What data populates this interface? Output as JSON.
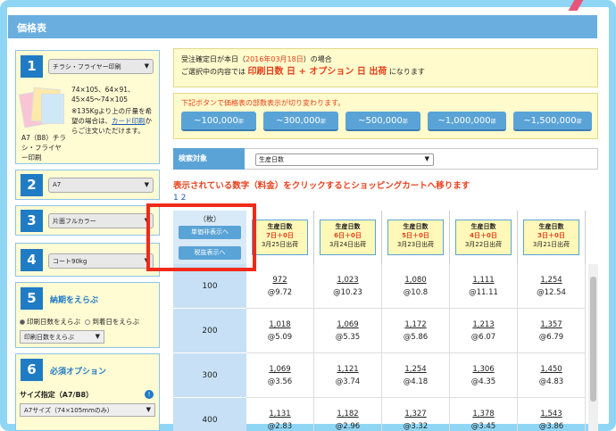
{
  "header": {
    "title": "価格表"
  },
  "sidebar": {
    "s1": {
      "num": "1",
      "select": "チラシ・フライヤー印刷",
      "sizes": "74×105、64×91、45×45〜74×105",
      "note1": "※135Kgより上の斤量を希望の場合は、",
      "note_link": "カード印刷",
      "note2": "からご注文いただけます。",
      "caption": "A7（B8）チラシ・フライヤー印刷"
    },
    "s2": {
      "num": "2",
      "select": "A7"
    },
    "s3": {
      "num": "3",
      "select": "片面フルカラー"
    },
    "s4": {
      "num": "4",
      "select": "コート90kg"
    },
    "s5": {
      "num": "5",
      "title": "納期をえらぶ",
      "radio1": "印刷日数をえらぶ",
      "radio2": "到着日をえらぶ",
      "select": "印刷日数をえらぶ"
    },
    "s6": {
      "num": "6",
      "title": "必須オプション",
      "sub": "サイズ指定（A7/B8）",
      "select": "A7サイズ（74×105mmのみ）"
    }
  },
  "notice": {
    "line1a": "受注確定日が本日（",
    "date": "2016年03月18日",
    "line1b": "）の場合",
    "line2a": "ご選択中の内容では ",
    "days": "印刷日数 日",
    "plus": " + ",
    "opt": "オプション 日 出荷",
    "line2b": " になります"
  },
  "qty": {
    "note": "下記ボタンで価格表の部数表示が切り変わります。",
    "buttons": [
      {
        "label": "~100,000",
        "unit": "部"
      },
      {
        "label": "~300,000",
        "unit": "部"
      },
      {
        "label": "~500,000",
        "unit": "部"
      },
      {
        "label": "~1,000,000",
        "unit": "部"
      },
      {
        "label": "~1,500,000",
        "unit": "部"
      }
    ]
  },
  "filter": {
    "label": "検索対象",
    "select": "生産日数"
  },
  "info": "表示されている数字（料金）をクリックするとショッピングカートへ移ります",
  "pages": "1 2",
  "table": {
    "corner": "（枚）",
    "btn_unit": "単価非表示へ",
    "btn_tax": "税抜表示へ",
    "headers": [
      {
        "t": "生産日数",
        "d": "7日＋0日",
        "s": "3月25日出荷"
      },
      {
        "t": "生産日数",
        "d": "6日＋0日",
        "s": "3月24日出荷"
      },
      {
        "t": "生産日数",
        "d": "5日＋0日",
        "s": "3月23日出荷"
      },
      {
        "t": "生産日数",
        "d": "4日＋0日",
        "s": "3月22日出荷"
      },
      {
        "t": "生産日数",
        "d": "3日＋0日",
        "s": "3月21日出荷"
      }
    ],
    "rows": [
      {
        "q": "100",
        "cells": [
          [
            "972",
            "@9.72"
          ],
          [
            "1,023",
            "@10.23"
          ],
          [
            "1,080",
            "@10.8"
          ],
          [
            "1,111",
            "@11.11"
          ],
          [
            "1,254",
            "@12.54"
          ]
        ]
      },
      {
        "q": "200",
        "cells": [
          [
            "1,018",
            "@5.09"
          ],
          [
            "1,069",
            "@5.35"
          ],
          [
            "1,172",
            "@5.86"
          ],
          [
            "1,213",
            "@6.07"
          ],
          [
            "1,357",
            "@6.79"
          ]
        ]
      },
      {
        "q": "300",
        "cells": [
          [
            "1,069",
            "@3.56"
          ],
          [
            "1,121",
            "@3.74"
          ],
          [
            "1,254",
            "@4.18"
          ],
          [
            "1,306",
            "@4.35"
          ],
          [
            "1,450",
            "@4.83"
          ]
        ]
      },
      {
        "q": "400",
        "cells": [
          [
            "1,131",
            "@2.83"
          ],
          [
            "1,182",
            "@2.96"
          ],
          [
            "1,327",
            "@3.32"
          ],
          [
            "1,378",
            "@3.45"
          ],
          [
            "1,543",
            "@3.86"
          ]
        ]
      }
    ]
  },
  "colors": {
    "accent": "#5aa3d6",
    "highlight": "#f02a1a",
    "frame": "#8fd6f5"
  }
}
